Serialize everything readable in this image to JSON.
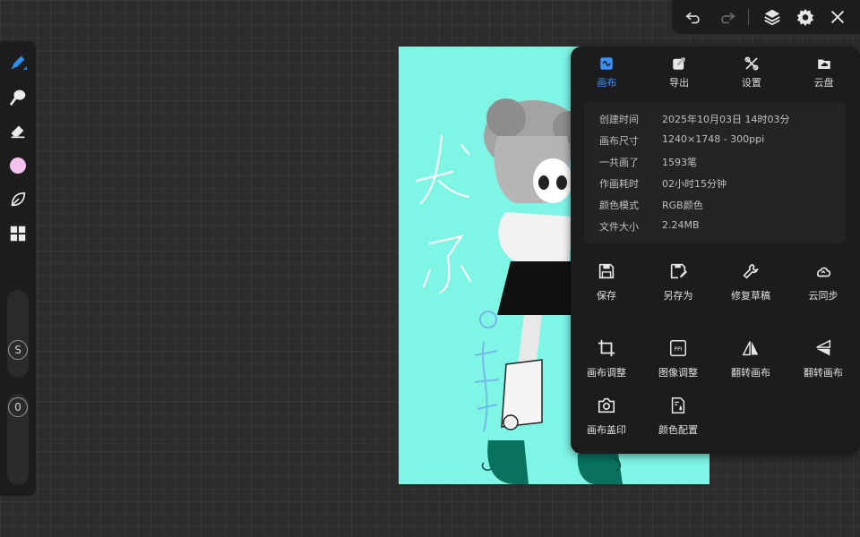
{
  "toolbar": {
    "tools": [
      "brush-tool",
      "smudge-tool",
      "eraser-tool",
      "color-picker",
      "leaf-tool",
      "layers-grid-tool"
    ],
    "current_color": "#f5c2f0",
    "size_knob_label": "S",
    "opacity_knob_label": "0"
  },
  "topbar": {
    "buttons": [
      "undo",
      "redo",
      "layers",
      "settings",
      "close"
    ]
  },
  "canvas": {
    "background": "#7ff5e6"
  },
  "panel": {
    "tabs": [
      {
        "label": "画布",
        "icon": "canvas-icon",
        "active": true
      },
      {
        "label": "导出",
        "icon": "export-icon",
        "active": false
      },
      {
        "label": "设置",
        "icon": "tools-icon",
        "active": false
      },
      {
        "label": "云盘",
        "icon": "cloud-folder-icon",
        "active": false
      }
    ],
    "info": [
      {
        "key": "创建时间",
        "value": "2025年10月03日 14时03分"
      },
      {
        "key": "画布尺寸",
        "value": "1240×1748 - 300ppi"
      },
      {
        "key": "一共画了",
        "value": "1593笔"
      },
      {
        "key": "作画耗时",
        "value": "02小时15分钟"
      },
      {
        "key": "颜色模式",
        "value": "RGB颜色"
      },
      {
        "key": "文件大小",
        "value": "2.24MB"
      }
    ],
    "actions": [
      {
        "label": "保存",
        "icon": "save-icon"
      },
      {
        "label": "另存为",
        "icon": "save-as-icon"
      },
      {
        "label": "修复草稿",
        "icon": "wrench-icon"
      },
      {
        "label": "云同步",
        "icon": "cloud-sync-icon"
      },
      {
        "label": "画布调整",
        "icon": "crop-icon"
      },
      {
        "label": "图像调整",
        "icon": "ppi-icon"
      },
      {
        "label": "翻转画布",
        "icon": "flip-horizontal-icon"
      },
      {
        "label": "翻转画布",
        "icon": "flip-vertical-icon"
      },
      {
        "label": "画布盖印",
        "icon": "camera-icon"
      },
      {
        "label": "颜色配置",
        "icon": "color-profile-icon"
      }
    ],
    "accent": "#3b8ff0"
  }
}
